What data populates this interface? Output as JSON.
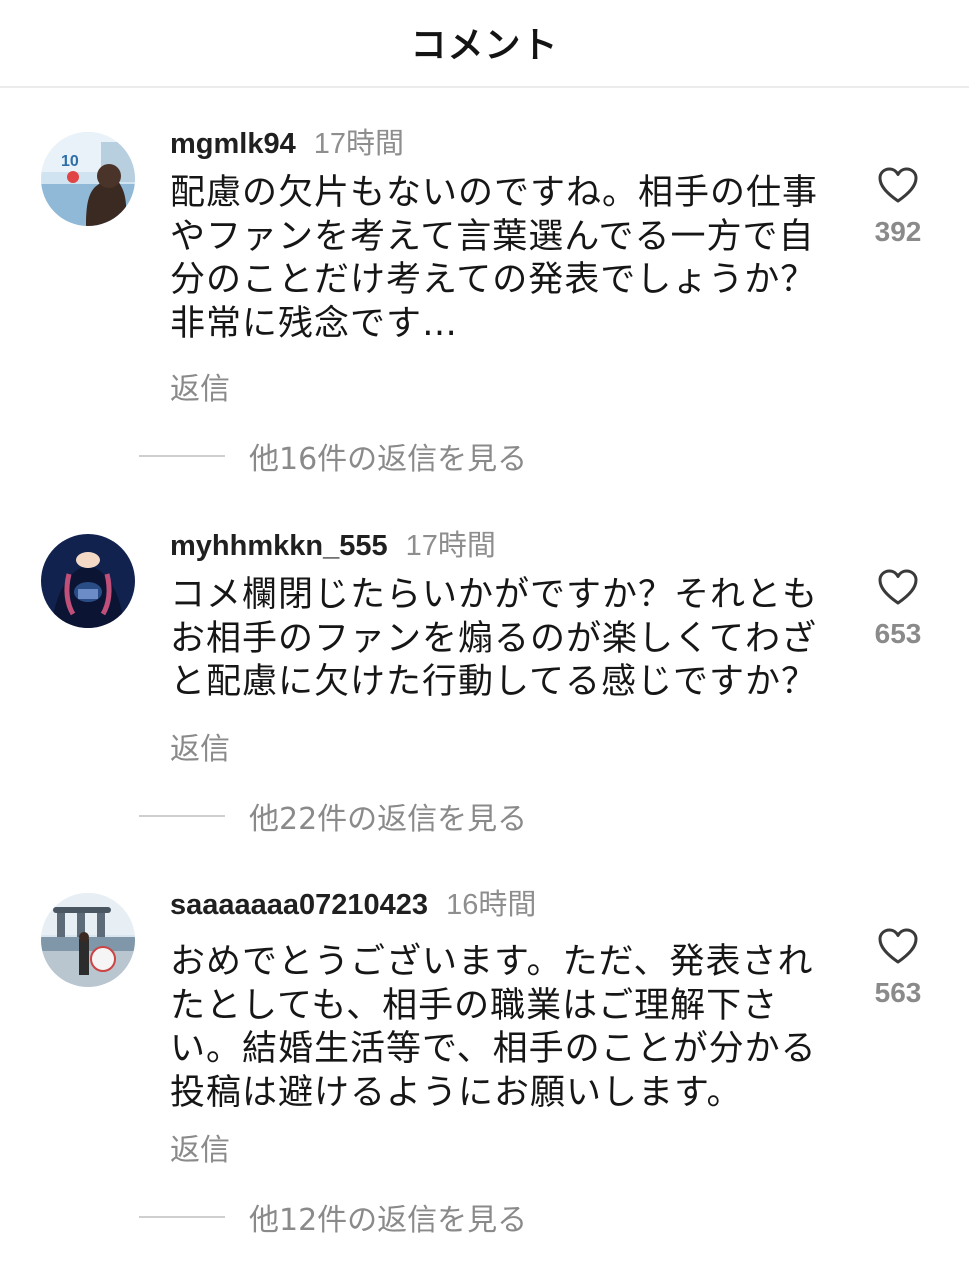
{
  "header": {
    "title": "コメント"
  },
  "comments": [
    {
      "username": "mgmlk94",
      "time": "17時間",
      "lines": [
        "配慮の欠片もないのですね。相手の仕事",
        "やファンを考えて言葉選んでる一方で自",
        "分のことだけ考えての発表でしょうか？",
        "非常に残念です…"
      ],
      "reply_label": "返信",
      "likes": "392",
      "view_replies": "他16件の返信を見る",
      "avatar_text": "10"
    },
    {
      "username": "myhhmkkn_555",
      "time": "17時間",
      "lines": [
        "コメ欄閉じたらいかがですか？それとも",
        "お相手のファンを煽るのが楽しくてわざ",
        "と配慮に欠けた行動してる感じですか？"
      ],
      "reply_label": "返信",
      "likes": "653",
      "view_replies": "他22件の返信を見る"
    },
    {
      "username": "saaaaaaa07210423",
      "time": "16時間",
      "lines": [
        "おめでとうございます。ただ、発表され",
        "たとしても、相手の職業はご理解下さ",
        "い。結婚生活等で、相手のことが分かる",
        "投稿は避けるようにお願いします。"
      ],
      "reply_label": "返信",
      "likes": "563",
      "view_replies": "他12件の返信を見る"
    }
  ],
  "icons": {
    "like": "heart-outline-icon"
  },
  "colors": {
    "muted": "#8a8a8a",
    "text": "#161616",
    "divider": "#ececec"
  }
}
